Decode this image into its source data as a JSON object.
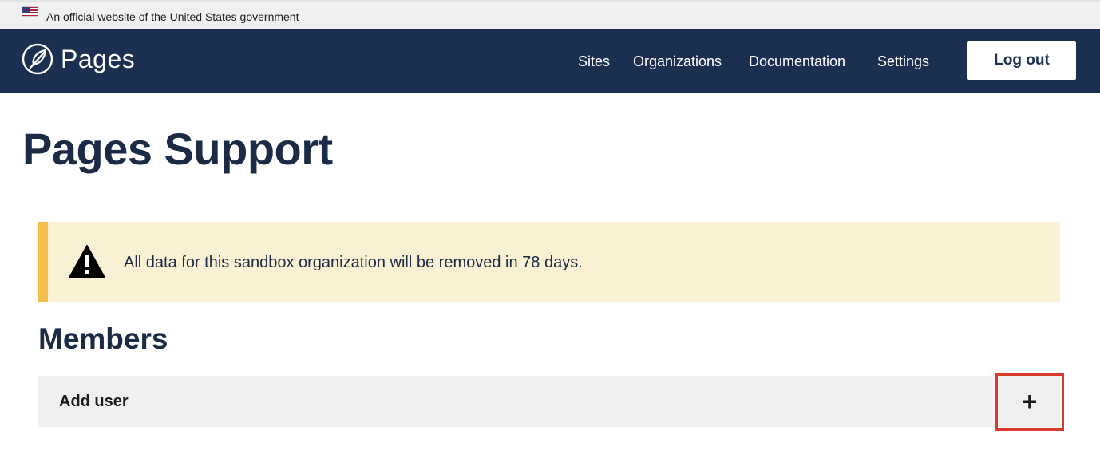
{
  "gov_banner": {
    "flag_icon": "us-flag-icon",
    "text": "An official website of the United States government"
  },
  "header": {
    "logo_icon": "feather-pen-icon",
    "logo_text": "Pages",
    "nav": [
      {
        "label": "Sites"
      },
      {
        "label": "Organizations"
      },
      {
        "label": "Documentation"
      },
      {
        "label": "Settings"
      }
    ],
    "logout_label": "Log out"
  },
  "page": {
    "title": "Pages Support"
  },
  "alert": {
    "icon": "warning-icon",
    "text": "All data for this sandbox organization will be removed in 78 days.",
    "accent_color": "#f4be4a",
    "background_color": "#faf0d4"
  },
  "members": {
    "title": "Members",
    "add_user_label": "Add user",
    "expand_icon": "plus-icon",
    "expand_symbol": "+"
  },
  "colors": {
    "header_bg": "#1b2f50",
    "title_color": "#1b2b45",
    "highlight": "#d93a2b"
  }
}
